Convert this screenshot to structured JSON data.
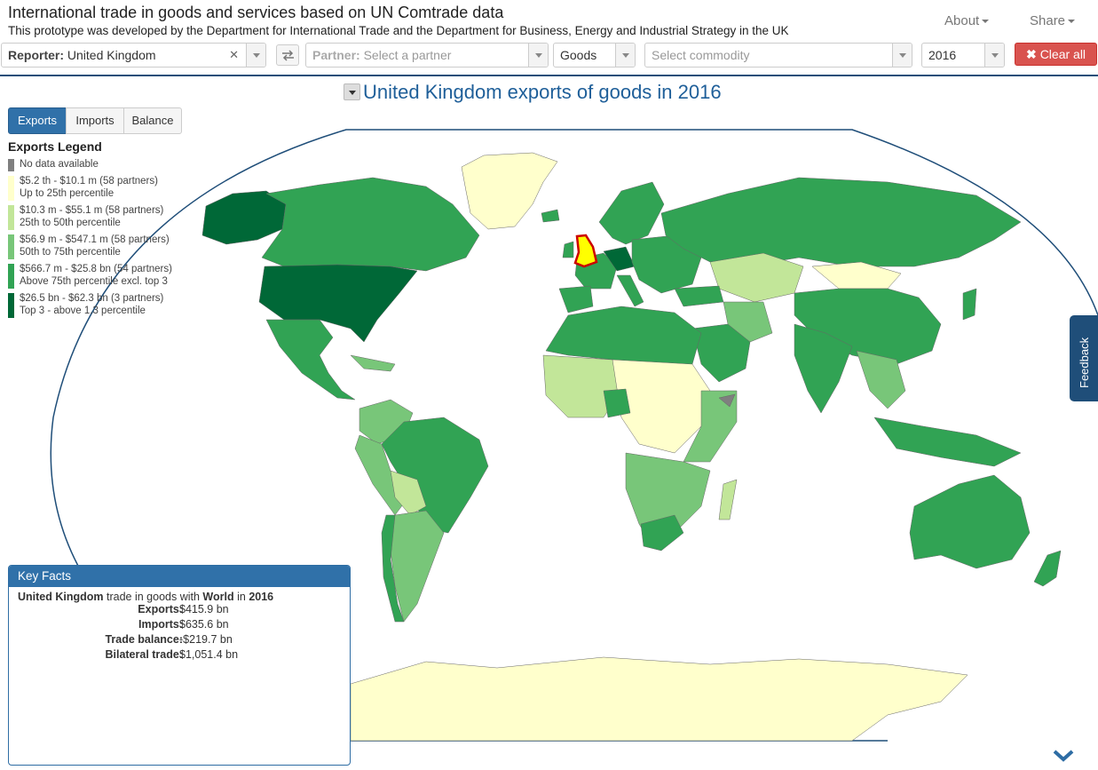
{
  "header": {
    "title": "International trade in goods and services based on UN Comtrade data",
    "subtitle": "This prototype was developed by the Department for International Trade and the Department for Business, Energy and Industrial Strategy in the UK",
    "nav": {
      "about": "About",
      "share": "Share"
    }
  },
  "filters": {
    "reporter_label": "Reporter:",
    "reporter_value": "United Kingdom",
    "partner_label": "Partner:",
    "partner_placeholder": "Select a partner",
    "type_value": "Goods",
    "commodity_placeholder": "Select commodity",
    "year_value": "2016",
    "clear_all": "Clear all"
  },
  "map": {
    "title": "United Kingdom exports of goods in 2016",
    "tabs": [
      "Exports",
      "Imports",
      "Balance"
    ],
    "active_tab": "Exports"
  },
  "legend": {
    "title": "Exports Legend",
    "items": [
      {
        "line1": "No data available",
        "line2": "",
        "color": "#7f7f7f"
      },
      {
        "line1": "$5.2 th - $10.1 m (58 partners)",
        "line2": "Up to 25th percentile",
        "color": "#ffffcc"
      },
      {
        "line1": "$10.3 m - $55.1 m (58 partners)",
        "line2": "25th to 50th percentile",
        "color": "#c2e699"
      },
      {
        "line1": "$56.9 m - $547.1 m (58 partners)",
        "line2": "50th to 75th percentile",
        "color": "#78c679"
      },
      {
        "line1": "$566.7 m - $25.8 bn (54 partners)",
        "line2": "Above 75th percentile excl. top 3",
        "color": "#31a354"
      },
      {
        "line1": "$26.5 bn - $62.3 bn (3 partners)",
        "line2": "Top 3 - above 1.3 percentile",
        "color": "#006837"
      }
    ]
  },
  "key_facts": {
    "header": "Key Facts",
    "reporter": "United Kingdom",
    "mid_text": "trade in goods with",
    "partner": "World",
    "in_text": "in",
    "year": "2016",
    "rows": [
      {
        "label": "Exports:",
        "value": "$415.9 bn"
      },
      {
        "label": "Imports:",
        "value": "$635.6 bn"
      },
      {
        "label": "Trade balance:",
        "value": "-$219.7 bn"
      },
      {
        "label": "Bilateral trade:",
        "value": "$1,051.4 bn"
      }
    ]
  },
  "feedback": "Feedback",
  "colors": {
    "accent": "#1f4e79",
    "tab_active": "#3071a9",
    "danger": "#d9534f",
    "highlight_uk": "#ffff00"
  }
}
